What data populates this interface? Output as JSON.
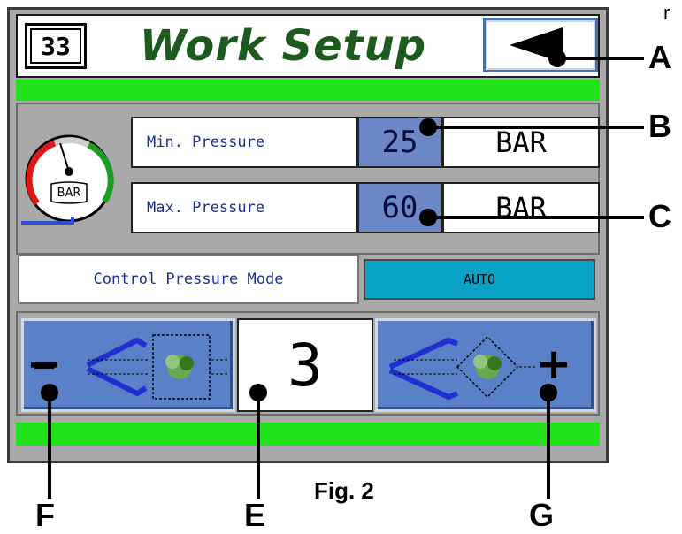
{
  "screen": {
    "number": "33",
    "title": "Work Setup",
    "back_icon": "left-arrow-icon"
  },
  "pressure": {
    "gauge_unit": "BAR",
    "min": {
      "label": "Min. Pressure",
      "value": "25",
      "unit": "BAR"
    },
    "max": {
      "label": "Max. Pressure",
      "value": "60",
      "unit": "BAR"
    }
  },
  "mode": {
    "label": "Control Pressure Mode",
    "value": "AUTO"
  },
  "step": {
    "value": "3",
    "decrease_symbol": "−",
    "increase_symbol": "+"
  },
  "callouts": {
    "a": "A",
    "b": "B",
    "c": "C",
    "e": "E",
    "f": "F",
    "g": "G"
  },
  "figure": {
    "caption": "Fig. 2"
  },
  "corner_text": "r",
  "colors": {
    "panel": "#a9a9a9",
    "green_bar": "#22e01a",
    "value_blue": "#6b87c6",
    "mode_cyan": "#0aa2c4",
    "title_green": "#1d5a1d",
    "label_blue": "#1c2f8f"
  }
}
